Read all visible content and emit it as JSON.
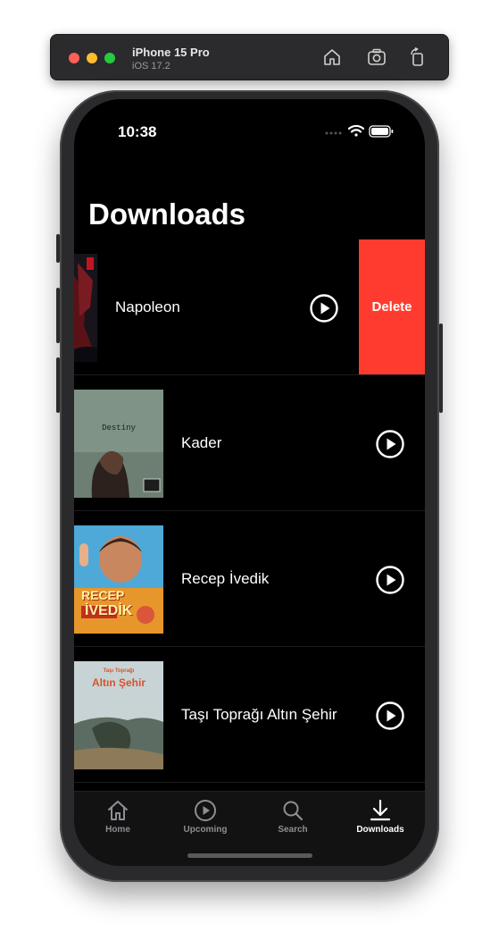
{
  "simulator": {
    "device_name": "iPhone 15 Pro",
    "os_version": "iOS 17.2"
  },
  "status_bar": {
    "time": "10:38"
  },
  "page": {
    "title": "Downloads"
  },
  "downloads": [
    {
      "title": "Napoleon",
      "swiped": true
    },
    {
      "title": "Kader",
      "poster_text": "Destiny"
    },
    {
      "title": "Recep İvedik",
      "poster_text_top": "RECEP",
      "poster_text_bottom": "İVEDİK"
    },
    {
      "title": "Taşı Toprağı Altın Şehir",
      "poster_text_top": "Taşı Toprağı",
      "poster_text_bottom": "Altın Şehir"
    }
  ],
  "swipe_action": {
    "delete_label": "Delete",
    "color": "#ff3b30"
  },
  "tabbar": {
    "tabs": [
      {
        "label": "Home",
        "icon": "house-icon",
        "active": false
      },
      {
        "label": "Upcoming",
        "icon": "play-circle-icon",
        "active": false
      },
      {
        "label": "Search",
        "icon": "magnifyingglass-icon",
        "active": false
      },
      {
        "label": "Downloads",
        "icon": "arrow-down-tray-icon",
        "active": true
      }
    ]
  }
}
